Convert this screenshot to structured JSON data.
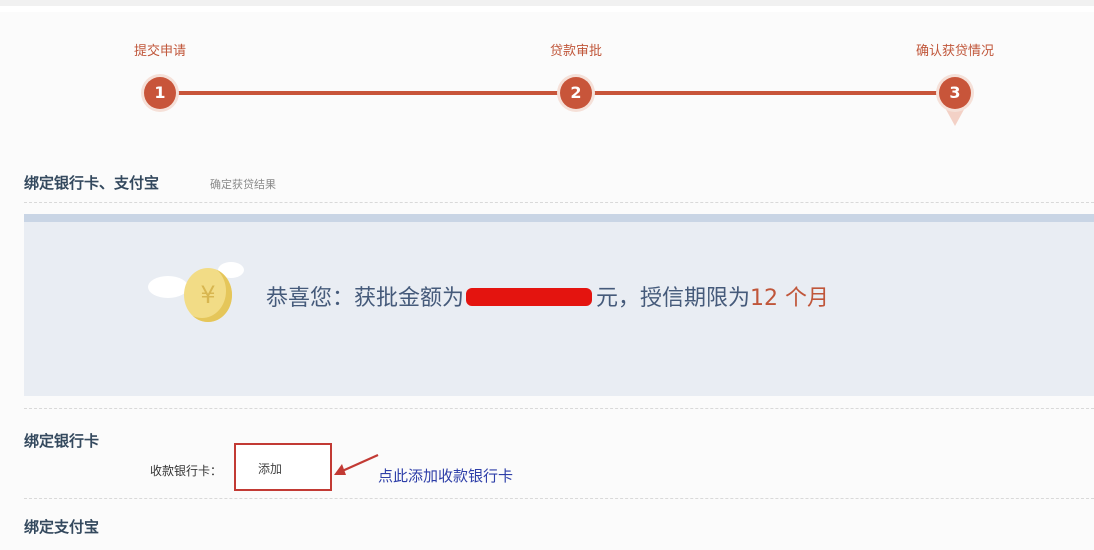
{
  "steps": [
    {
      "number": "1",
      "label": "提交申请"
    },
    {
      "number": "2",
      "label": "贷款审批"
    },
    {
      "number": "3",
      "label": "确认获贷情况"
    }
  ],
  "section": {
    "title": "绑定银行卡、支付宝",
    "subtitle": "确定获贷结果"
  },
  "banner": {
    "prefix": "恭喜您：获批金额为",
    "amount_redacted": true,
    "middle": "元，授信期限为",
    "term_value": "12 个月"
  },
  "bank": {
    "heading": "绑定银行卡",
    "field_label": "收款银行卡：",
    "add_label": "添加",
    "hint": "点此添加收款银行卡"
  },
  "alipay": {
    "heading": "绑定支付宝"
  },
  "colors": {
    "accent": "#c8553a",
    "annotation_red": "#c23a34",
    "hint_blue": "#2d3ea8",
    "banner_bg": "#e9edf3"
  }
}
